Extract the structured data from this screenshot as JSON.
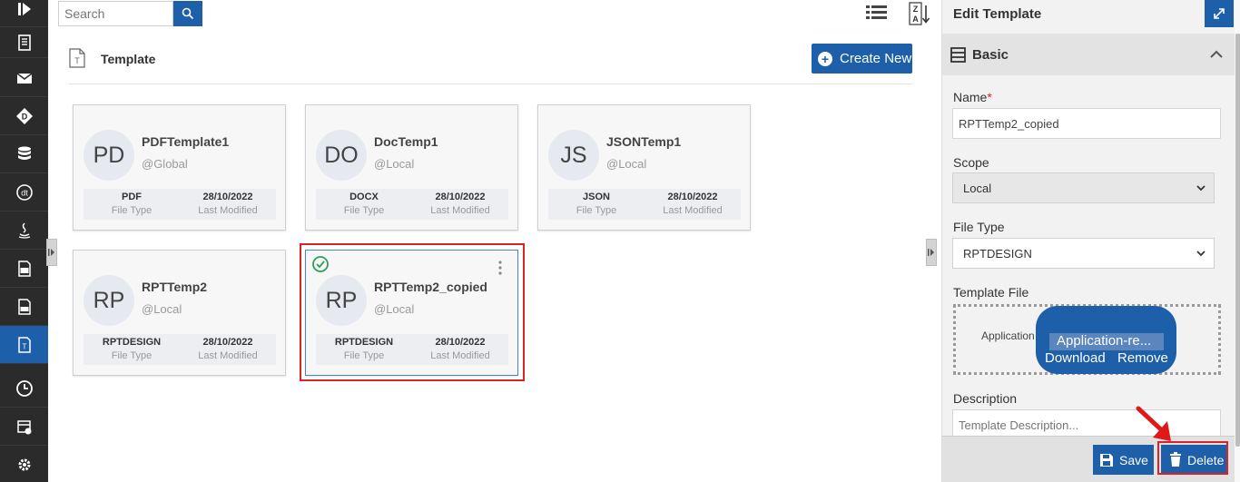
{
  "search": {
    "placeholder": "Search"
  },
  "header": {
    "title": "Template",
    "create_label": "Create New"
  },
  "cards": [
    {
      "initials": "PD",
      "name": "PDFTemplate1",
      "scope": "@Global",
      "file_type": "PDF",
      "file_type_label": "File Type",
      "modified": "28/10/2022",
      "modified_label": "Last Modified"
    },
    {
      "initials": "DO",
      "name": "DocTemp1",
      "scope": "@Local",
      "file_type": "DOCX",
      "file_type_label": "File Type",
      "modified": "28/10/2022",
      "modified_label": "Last Modified"
    },
    {
      "initials": "JS",
      "name": "JSONTemp1",
      "scope": "@Local",
      "file_type": "JSON",
      "file_type_label": "File Type",
      "modified": "28/10/2022",
      "modified_label": "Last Modified"
    },
    {
      "initials": "RP",
      "name": "RPTTemp2",
      "scope": "@Local",
      "file_type": "RPTDESIGN",
      "file_type_label": "File Type",
      "modified": "28/10/2022",
      "modified_label": "Last Modified"
    },
    {
      "initials": "RP",
      "name": "RPTTemp2_copied",
      "scope": "@Local",
      "file_type": "RPTDESIGN",
      "file_type_label": "File Type",
      "modified": "28/10/2022",
      "modified_label": "Last Modified"
    }
  ],
  "panel": {
    "title": "Edit Template",
    "section_title": "Basic",
    "name_label": "Name",
    "name_required": "*",
    "name_value": "RPTTemp2_copied",
    "scope_label": "Scope",
    "scope_value": "Local",
    "file_type_label": "File Type",
    "file_type_value": "RPTDESIGN",
    "template_file_label": "Template File",
    "template_file_text": "Application",
    "template_file_name": "Application-re...",
    "download_label": "Download",
    "remove_label": "Remove",
    "description_label": "Description",
    "description_placeholder": "Template Description...",
    "save_label": "Save",
    "delete_label": "Delete"
  },
  "rail_icons": [
    "expand-nav-icon",
    "document-icon",
    "mail-icon",
    "diamond-d-icon",
    "database-icon",
    "dt-icon",
    "java-icon",
    "ts-file-icon",
    "css-file-icon",
    "template-icon",
    "clock-icon",
    "calendar-settings-icon",
    "gear-icon"
  ],
  "colors": {
    "accent": "#1d5fa8",
    "highlight": "#d9232b",
    "rail": "#2b2b2b",
    "success": "#2e9e5b"
  }
}
